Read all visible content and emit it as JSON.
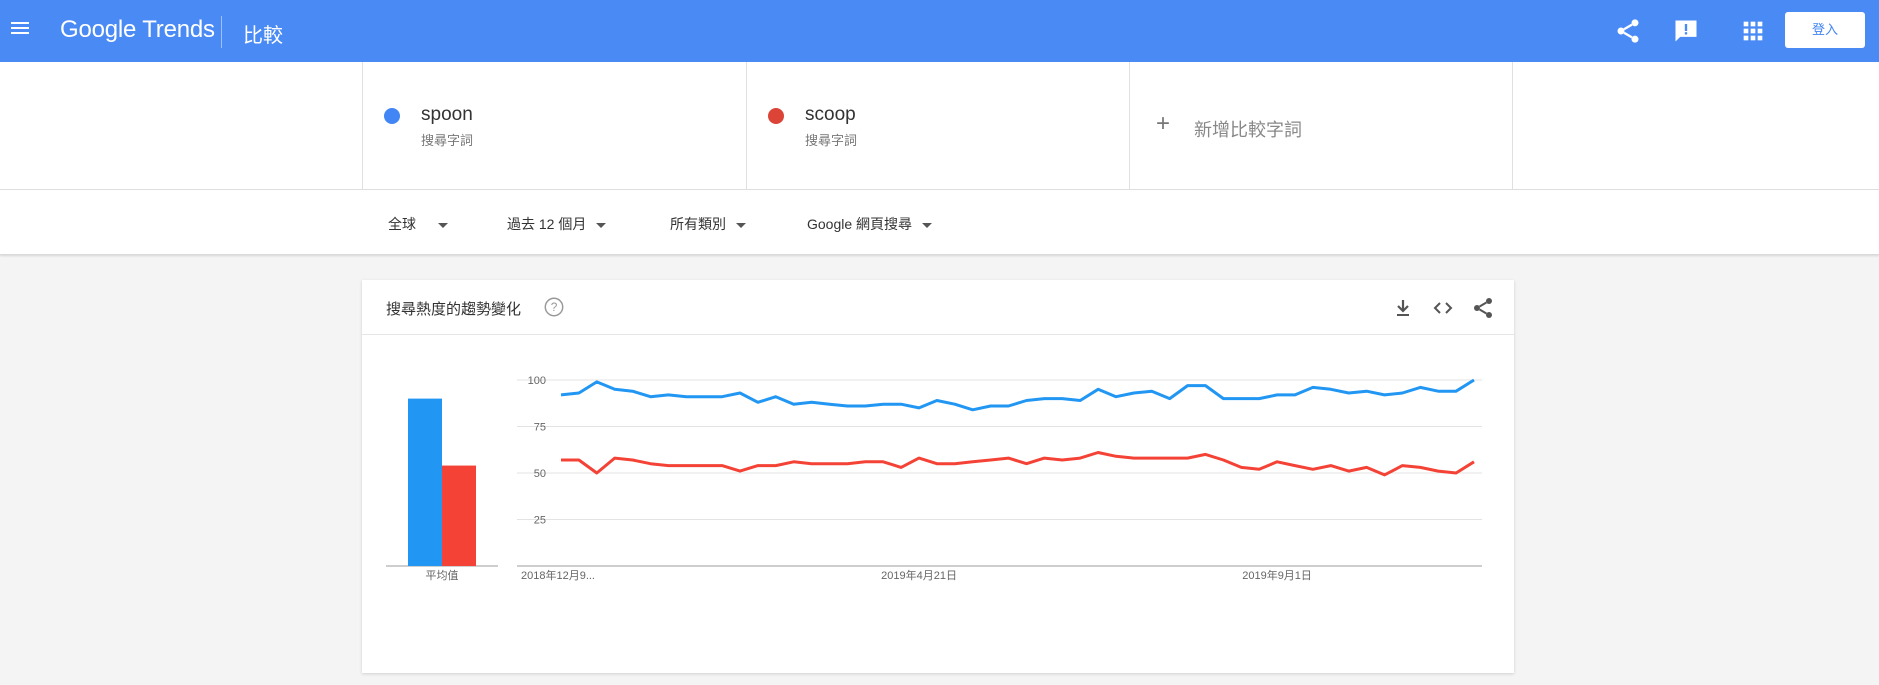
{
  "header": {
    "logo": "Google Trends",
    "page_title": "比較",
    "login_label": "登入",
    "icons": [
      "menu-icon",
      "share-icon",
      "feedback-icon",
      "apps-icon"
    ]
  },
  "terms": [
    {
      "name": "spoon",
      "subtitle": "搜尋字詞",
      "color": "#4285f4"
    },
    {
      "name": "scoop",
      "subtitle": "搜尋字詞",
      "color": "#db4437"
    }
  ],
  "add_term": {
    "label": "新增比較字詞"
  },
  "filters": {
    "region": "全球",
    "time": "過去 12 個月",
    "category": "所有類別",
    "property": "Google 網頁搜尋"
  },
  "card": {
    "title": "搜尋熱度的趨勢變化",
    "icons": [
      "help-icon",
      "download-icon",
      "embed-icon",
      "share-icon"
    ]
  },
  "chart_data": {
    "type": "line",
    "ylim": [
      0,
      100
    ],
    "yticks": [
      25,
      50,
      75,
      100
    ],
    "xtick_labels": [
      "2018年12月9...",
      "2019年4月21日",
      "2019年9月1日"
    ],
    "xtick_indices": [
      0,
      20,
      40
    ],
    "average_label": "平均值",
    "averages": [
      90,
      54
    ],
    "series": [
      {
        "name": "spoon",
        "color": "#2196f3",
        "values": [
          92,
          93,
          99,
          95,
          94,
          91,
          92,
          91,
          91,
          91,
          93,
          88,
          91,
          87,
          88,
          87,
          86,
          86,
          87,
          87,
          85,
          89,
          87,
          84,
          86,
          86,
          89,
          90,
          90,
          89,
          95,
          91,
          93,
          94,
          90,
          97,
          97,
          90,
          90,
          90,
          92,
          92,
          96,
          95,
          93,
          94,
          92,
          93,
          96,
          94,
          94,
          100
        ]
      },
      {
        "name": "scoop",
        "color": "#f44336",
        "values": [
          57,
          57,
          50,
          58,
          57,
          55,
          54,
          54,
          54,
          54,
          51,
          54,
          54,
          56,
          55,
          55,
          55,
          56,
          56,
          53,
          58,
          55,
          55,
          56,
          57,
          58,
          55,
          58,
          57,
          58,
          61,
          59,
          58,
          58,
          58,
          58,
          60,
          57,
          53,
          52,
          56,
          54,
          52,
          54,
          51,
          53,
          49,
          54,
          53,
          51,
          50,
          56
        ]
      }
    ]
  }
}
